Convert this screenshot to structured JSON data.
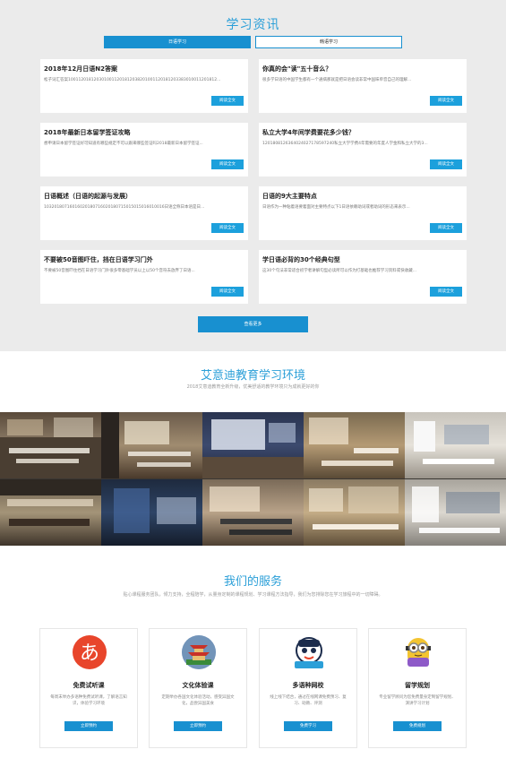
{
  "news": {
    "title": "学习资讯",
    "tabs": [
      {
        "label": "日语学习",
        "active": true
      },
      {
        "label": "韩语学习",
        "active": false
      }
    ],
    "articles": [
      {
        "title": "2018年12月日语N2答案",
        "excerpt": "松子词汇答案1001120181203010011201812038201001120181203383010011201812..."
      },
      {
        "title": "你真的会\"读\"五十音么？",
        "excerpt": "很多学日语的中国学生都有一个通病那就是把日语会读非常中国味单音自己的理解..."
      },
      {
        "title": "2018年最新日本留学签证攻略",
        "excerpt": "想申请日本留学签证好可知道有哪些规定不可以跟来哪些签证吗2018最新日本留学签证..."
      },
      {
        "title": "私立大学4年间学费要花多少钱？",
        "excerpt": "1201808126364024027178597240私立大学学费4年需要的年度人学金和私立大学的3..."
      },
      {
        "title": "日语概述（日语的起源与发展）",
        "excerpt": "10320180716016020180716020180715015015016010016日语全称日本语是日..."
      },
      {
        "title": "日语的9大主要特点",
        "excerpt": "日语作为一种粘着语要着面对主要特点以下1日语依赖助词或者助词的形态来表示..."
      },
      {
        "title": "不要被50音图吓住，挡在日语学习门外",
        "excerpt": "不要被50音图吓住挡在日语学习门外很多零基础学员以上以50个音符去放弃了日语..."
      },
      {
        "title": "学日语必背的30个经典句型",
        "excerpt": "这30个句法非常适合初学者讲解句型必读所可以作为打基础也推荐学习资料或快收藏..."
      }
    ],
    "read_more_label": "阅读全文",
    "more_button": "查看更多"
  },
  "environment": {
    "title": "艾意迪教育学习环境",
    "subtitle": "2018艾意迪教育全新升级，优美舒适的教学环境只为成就更好的你"
  },
  "services": {
    "title": "我们的服务",
    "subtitle": "贴心课程服务团队，倾力支持，全程陪学，从量身定制的课程规划、学习课程方法指导，我们为您排除您在学习旅程中的一切障碍。",
    "items": [
      {
        "name": "免费试听课",
        "desc": "每周末举办多语种免费试听课，了解语言知识，体验学习环境",
        "button": "立即预约",
        "icon": "a-character-icon",
        "color": "#e8452b"
      },
      {
        "name": "文化体验课",
        "desc": "定期举办各国文化体验活动，感受异国文化，品尝异国美食",
        "button": "立即预约",
        "icon": "pagoda-icon",
        "color": "#2f6fbf"
      },
      {
        "name": "多语种网校",
        "desc": "线上线下结合，通过在线网课免费预习、复习、助教、评测",
        "button": "免费学习",
        "icon": "mascot-icon",
        "color": "#2b9fd8"
      },
      {
        "name": "留学规划",
        "desc": "专业留学顾问为您免费量身定制留学规划、演讲学习计划",
        "button": "免费规划",
        "icon": "minion-icon",
        "color": "#f3c431"
      }
    ]
  }
}
